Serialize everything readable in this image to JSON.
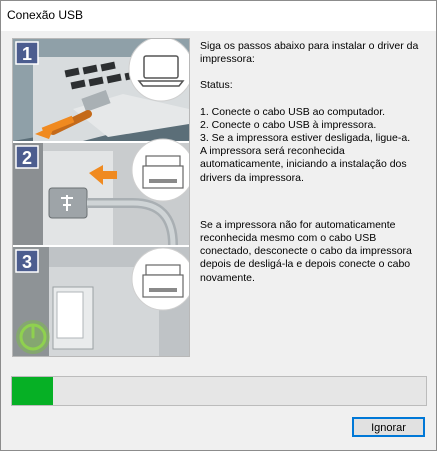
{
  "window": {
    "title": "Conexão USB"
  },
  "illustration": {
    "steps": [
      {
        "number": "1"
      },
      {
        "number": "2"
      },
      {
        "number": "3"
      }
    ]
  },
  "instructions": {
    "intro": "Siga os passos abaixo para instalar o driver da impressora:",
    "status_label": "Status:",
    "steps": [
      "1. Conecte o cabo USB ao computador.",
      "2. Conecte o cabo USB à impressora.",
      "3. Se a impressora estiver desligada, ligue-a."
    ],
    "auto_note": "A impressora será reconhecida automaticamente, iniciando a instalação dos drivers da impressora.",
    "fallback_note": "Se a impressora não for automaticamente reconhecida mesmo com o cabo USB conectado, desconecte o cabo da impressora depois de desligá-la e depois conecte o cabo novamente."
  },
  "progress": {
    "fraction": 0.1,
    "color": "#06b025"
  },
  "buttons": {
    "ignore_label": "Ignorar"
  }
}
